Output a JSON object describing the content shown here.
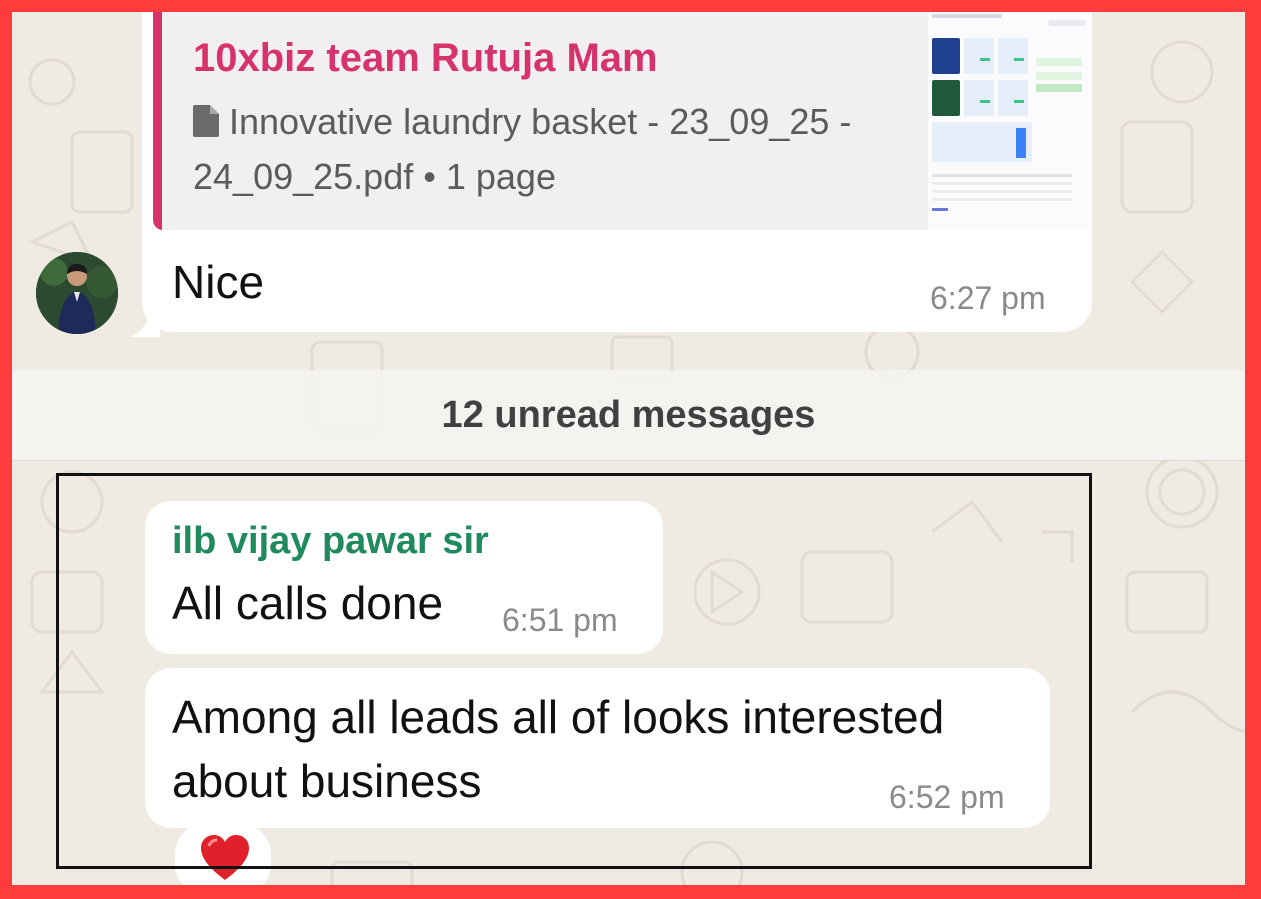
{
  "quoted_message": {
    "author": "10xbiz team Rutuja Mam",
    "file_name": "Innovative laundry basket - 23_09_25 - 24_09_25.pdf",
    "separator": "•",
    "page_count": "1 page",
    "file_icon": "document-icon"
  },
  "messages": [
    {
      "text": "Nice",
      "time": "6:27 pm"
    },
    {
      "sender": "ilb vijay pawar sir",
      "text": "All calls done",
      "time": "6:51 pm"
    },
    {
      "text": "Among all leads all of looks interested about business",
      "time": "6:52 pm",
      "reaction": "❤️"
    }
  ],
  "unread_divider": "12 unread messages",
  "colors": {
    "frame": "#ff3b3b",
    "chat_background": "#efeae2",
    "quote_author": "#d6336c",
    "sender_name": "#1f8a5e"
  }
}
